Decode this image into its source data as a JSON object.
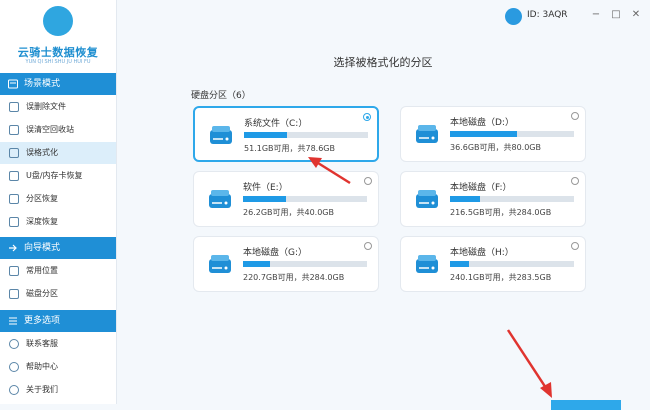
{
  "app": {
    "logo_title": "云骑士数据恢复",
    "logo_sub": "YUN QI SHI SHU JU HUI FU",
    "user_id": "ID: 3AQR"
  },
  "window_controls": {
    "minimize": "−",
    "maximize": "□",
    "close": "✕"
  },
  "sidebar": {
    "sections": [
      {
        "title": "场景模式",
        "items": [
          "误删除文件",
          "误清空回收站",
          "误格式化",
          "U盘/内存卡恢复",
          "分区恢复",
          "深度恢复"
        ]
      },
      {
        "title": "向导模式",
        "items": [
          "常用位置",
          "磁盘分区"
        ]
      },
      {
        "title": "更多选项",
        "items": [
          "联系客服",
          "帮助中心",
          "关于我们"
        ]
      }
    ],
    "active_item": "误格式化"
  },
  "main": {
    "title": "选择被格式化的分区",
    "section_label": "硬盘分区（6）",
    "partitions": [
      {
        "name": "系统文件（C:）",
        "capacity": "51.1GB可用，共78.6GB",
        "used_fraction": 0.35,
        "selected": true
      },
      {
        "name": "本地磁盘（D:）",
        "capacity": "36.6GB可用，共80.0GB",
        "used_fraction": 0.54,
        "selected": false
      },
      {
        "name": "软件（E:）",
        "capacity": "26.2GB可用，共40.0GB",
        "used_fraction": 0.35,
        "selected": false
      },
      {
        "name": "本地磁盘（F:）",
        "capacity": "216.5GB可用，共284.0GB",
        "used_fraction": 0.24,
        "selected": false
      },
      {
        "name": "本地磁盘（G:）",
        "capacity": "220.7GB可用，共284.0GB",
        "used_fraction": 0.22,
        "selected": false
      },
      {
        "name": "本地磁盘（H:）",
        "capacity": "240.1GB可用，共283.5GB",
        "used_fraction": 0.15,
        "selected": false
      }
    ]
  },
  "colors": {
    "accent": "#1f8fd6",
    "bar_fill": "#1f9ae6",
    "arrow": "#e0342f"
  }
}
